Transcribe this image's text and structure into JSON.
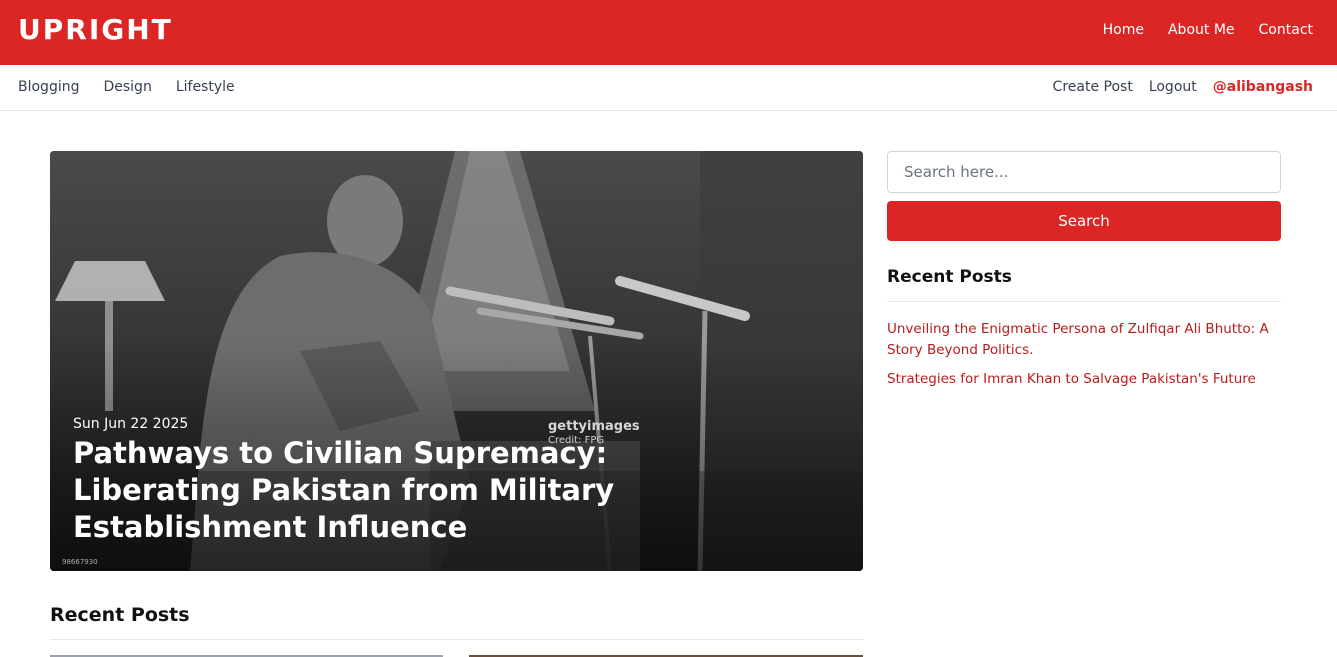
{
  "brand": {
    "logo": "UPRIGHT",
    "accent": "#dc2626"
  },
  "topnav": [
    "Home",
    "About Me",
    "Contact"
  ],
  "categories": [
    "Blogging",
    "Design",
    "Lifestyle"
  ],
  "usernav": {
    "create": "Create Post",
    "logout": "Logout",
    "handle": "@alibangash"
  },
  "hero": {
    "date": "Sun Jun 22 2025",
    "title": "Pathways to Civilian Supremacy: Liberating Pakistan from Military Establishment Influence",
    "watermark": "gettyimages",
    "credit": "Credit: FPG",
    "image_id": "98667930"
  },
  "main": {
    "recent_heading": "Recent Posts"
  },
  "sidebar": {
    "search_placeholder": "Search here...",
    "search_button": "Search",
    "recent_heading": "Recent Posts",
    "recent_posts": [
      "Unveiling the Enigmatic Persona of Zulfiqar Ali Bhutto: A Story Beyond Politics.",
      "Strategies for Imran Khan to Salvage Pakistan's Future"
    ]
  }
}
